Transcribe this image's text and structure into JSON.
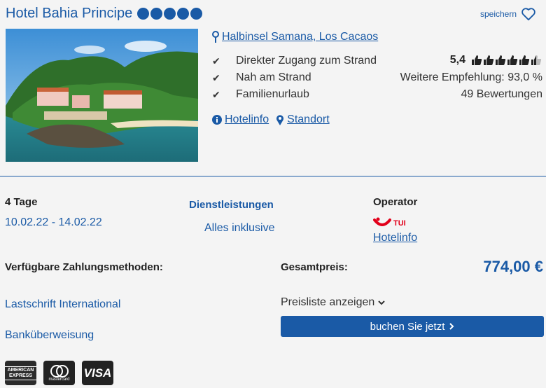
{
  "hotel": {
    "name": "Hotel Bahia Principe",
    "stars": 5,
    "save_label": "speichern",
    "location": "Halbinsel Samana, Los Cacaos",
    "features": [
      "Direkter Zugang zum Strand",
      "Nah am Strand",
      "Familienurlaub"
    ],
    "rating_score": "5,4",
    "rating_thumbs_filled": 5.5,
    "recommendation": "Weitere Empfehlung: 93,0 %",
    "reviews": "49 Bewertungen",
    "link_hotelinfo": "Hotelinfo",
    "link_standort": "Standort"
  },
  "offer": {
    "duration": "4 Tage",
    "dates": "10.02.22 - 14.02.22",
    "services_label": "Dienstleistungen",
    "services_value": "Alles inklusive",
    "operator_label": "Operator",
    "operator_logo_text": "TUI",
    "operator_link": "Hotelinfo",
    "payment_label": "Verfügbare Zahlungsmethoden:",
    "payment_methods": [
      "Lastschrift International",
      "Banküberweisung"
    ],
    "total_label": "Gesamtpreis:",
    "total_price": "774,00 €",
    "pricelist_label": "Preisliste anzeigen",
    "book_label": "buchen Sie jetzt",
    "cards": [
      "AMERICAN EXPRESS",
      "mastercard",
      "VISA"
    ]
  },
  "colors": {
    "brand": "#1a5aa6",
    "tui_red": "#e2001a"
  }
}
